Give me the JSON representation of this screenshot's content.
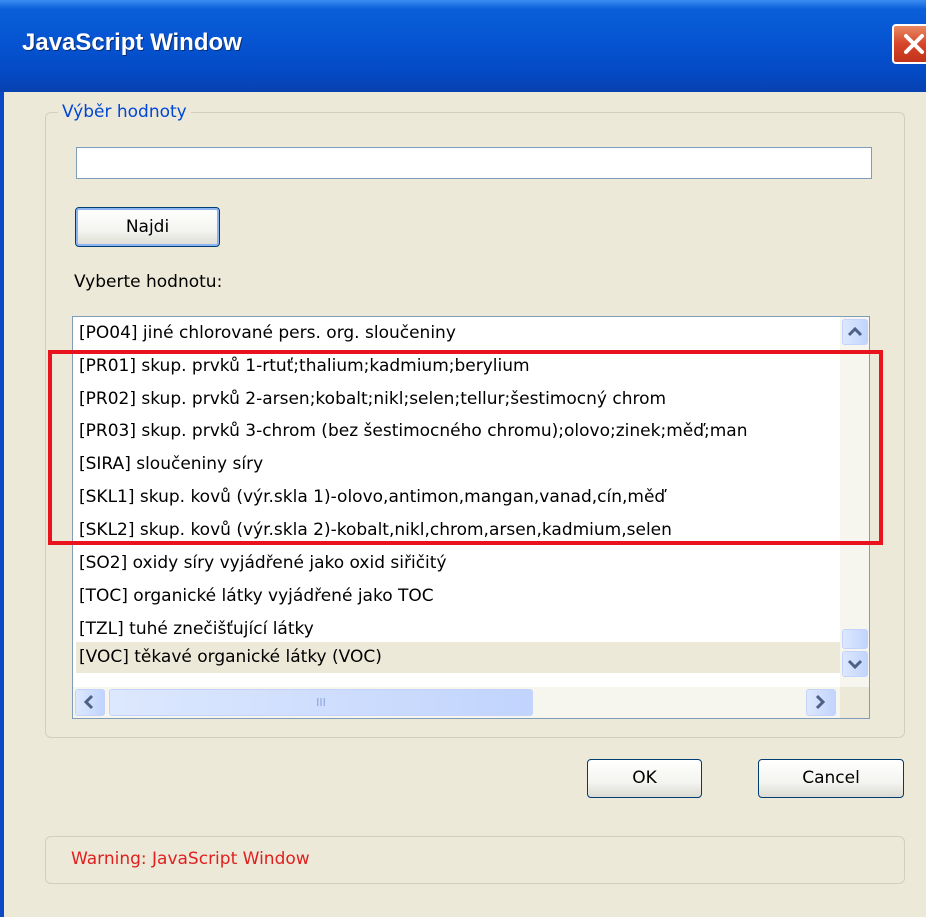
{
  "window": {
    "title": "JavaScript Window"
  },
  "group": {
    "legend": "Výběr hodnoty",
    "input_value": "",
    "find_button": "Najdi",
    "list_label": "Vyberte hodnotu:"
  },
  "list": {
    "items": [
      "[PO04] jiné chlorované pers. org. sloučeniny",
      "[PR01] skup. prvků 1-rtuť;thalium;kadmium;berylium",
      "[PR02] skup. prvků 2-arsen;kobalt;nikl;selen;tellur;šestimocný chrom",
      "[PR03] skup. prvků 3-chrom (bez šestimocného chromu);olovo;zinek;měď;man",
      "[SIRA] sloučeniny síry",
      "[SKL1] skup. kovů (výr.skla 1)-olovo,antimon,mangan,vanad,cín,měď",
      "[SKL2] skup. kovů (výr.skla 2)-kobalt,nikl,chrom,arsen,kadmium,selen",
      "[SO2] oxidy síry vyjádřené jako oxid siřičitý",
      "[TOC] organické látky vyjádřené jako TOC",
      "[TZL] tuhé znečišťující látky",
      "[VOC] těkavé organické látky (VOC)"
    ],
    "selected_index": 10,
    "hscroll_grip": "III"
  },
  "buttons": {
    "ok": "OK",
    "cancel": "Cancel"
  },
  "warning": {
    "text": "Warning: JavaScript Window"
  },
  "colors": {
    "titlebar": "#0654d2",
    "highlight_border": "#e8131c",
    "warning_text": "#e02020",
    "legend_text": "#0046d5"
  },
  "icons": {
    "close": "close-icon",
    "scroll_up": "chevron-up-icon",
    "scroll_down": "chevron-down-icon",
    "scroll_left": "chevron-left-icon",
    "scroll_right": "chevron-right-icon"
  }
}
